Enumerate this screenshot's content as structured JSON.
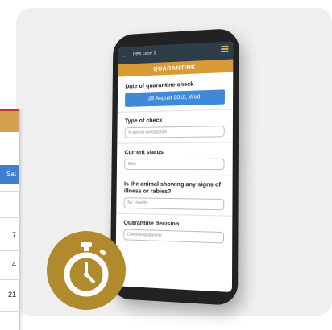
{
  "calendar": {
    "day_label": "Sat",
    "numbers": [
      "7",
      "14",
      "21"
    ],
    "colors": {
      "top_stripe": "#c0392b",
      "header": "#d4a150",
      "highlight": "#3f7fd1"
    }
  },
  "phone": {
    "appbar": {
      "title": "new case 1",
      "back_icon": "back-arrow-icon",
      "menu_icon": "hamburger-menu-icon"
    },
    "tab_title": "QUARANTINE",
    "form": {
      "date_label": "Date of quarantine check",
      "date_value": "29 August 2018, Wed",
      "type_label": "Type of check",
      "type_value": "In-person investigation",
      "status_label": "Current status",
      "status_value": "Alive",
      "signs_label": "Is the animal showing any signs of illness or rabies?",
      "signs_value": "No - healthy",
      "decision_label": "Quarantine decision",
      "decision_placeholder": "Continue quarantine"
    },
    "colors": {
      "appbar": "#2d3e49",
      "tab": "#d99b35",
      "date_box": "#3f8ad8"
    }
  },
  "badge": {
    "icon": "stopwatch-icon",
    "color": "#b28a2e"
  }
}
